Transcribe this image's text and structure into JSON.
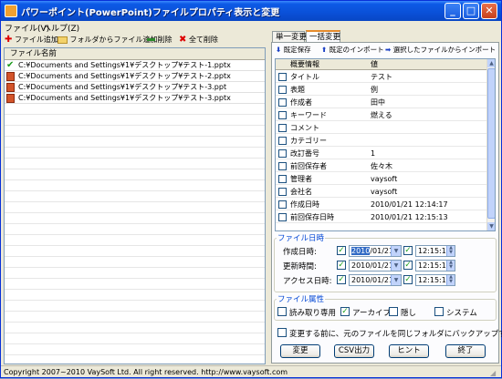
{
  "window": {
    "title": "パワーポイント(PowerPoint)ファイルプロパティ表示と変更",
    "minimize": "_",
    "maximize": "□",
    "close": "✕"
  },
  "menu": [
    "ファイル(V)",
    "ヘルプ(Z)"
  ],
  "left_toolbar": {
    "add_file": "ファイル追加",
    "add_from_folder": "フォルダからファイル追加",
    "delete": "削除",
    "delete_all": "全て削除"
  },
  "file_list": {
    "header": "ファイル名前",
    "rows": [
      {
        "path": "C:¥Documents and Settings¥1¥デスクトップ¥テスト-1.pptx",
        "icon": "check-icon"
      },
      {
        "path": "C:¥Documents and Settings¥1¥デスクトップ¥テスト-2.pptx",
        "icon": "ppt-icon"
      },
      {
        "path": "C:¥Documents and Settings¥1¥デスクトップ¥テスト-3.ppt",
        "icon": "ppt-icon"
      },
      {
        "path": "C:¥Documents and Settings¥1¥デスクトップ¥テスト-3.pptx",
        "icon": "ppt-icon"
      }
    ]
  },
  "tabs": {
    "single": "単一変更",
    "batch": "一括変更"
  },
  "right_toolbar": {
    "save_defaults": "既定保存",
    "import_defaults": "既定のインポート",
    "import_from_file": "選択したファイルからインポート"
  },
  "props_grid": {
    "col1": "概要情報",
    "col2": "値",
    "rows": [
      {
        "name": "タイトル",
        "value": "テスト"
      },
      {
        "name": "表題",
        "value": "例"
      },
      {
        "name": "作成者",
        "value": "田中"
      },
      {
        "name": "キーワード",
        "value": "燃える"
      },
      {
        "name": "コメント",
        "value": ""
      },
      {
        "name": "カテゴリー",
        "value": ""
      },
      {
        "name": "改訂番号",
        "value": "1"
      },
      {
        "name": "前回保存者",
        "value": "佐々木"
      },
      {
        "name": "管理者",
        "value": "vaysoft"
      },
      {
        "name": "会社名",
        "value": "vaysoft"
      },
      {
        "name": "作成日時",
        "value": "2010/01/21 12:14:17"
      },
      {
        "name": "前回保存日時",
        "value": "2010/01/21 12:15:13"
      }
    ]
  },
  "file_dates": {
    "legend": "ファイル日時",
    "rows": [
      {
        "label": "作成日時:",
        "date_sel": "2010",
        "date_rest": "/01/21",
        "time": "12:15:12"
      },
      {
        "label": "更新時間:",
        "date_sel": "",
        "date_rest": "2010/01/21",
        "time": "12:15:13"
      },
      {
        "label": "アクセス日時:",
        "date_sel": "",
        "date_rest": "2010/01/21",
        "time": "12:15:13"
      }
    ]
  },
  "file_attrs": {
    "legend": "ファイル属性",
    "readonly": "読み取り専用",
    "archive": "アーカイブ",
    "hidden": "隠し",
    "system": "システム"
  },
  "backup_text": "変更する前に、元のファイルを同じフォルダにバックアップする",
  "buttons": {
    "change": "変更",
    "csv": "CSV出力",
    "hint": "ヒント",
    "exit": "終了"
  },
  "status": "Copyright 2007~2010 VaySoft Ltd. All right reserved. http://www.vaysoft.com",
  "colors": {
    "title_bar": "#0a50d8",
    "selection": "#316ac5",
    "legend": "#0046d5"
  }
}
